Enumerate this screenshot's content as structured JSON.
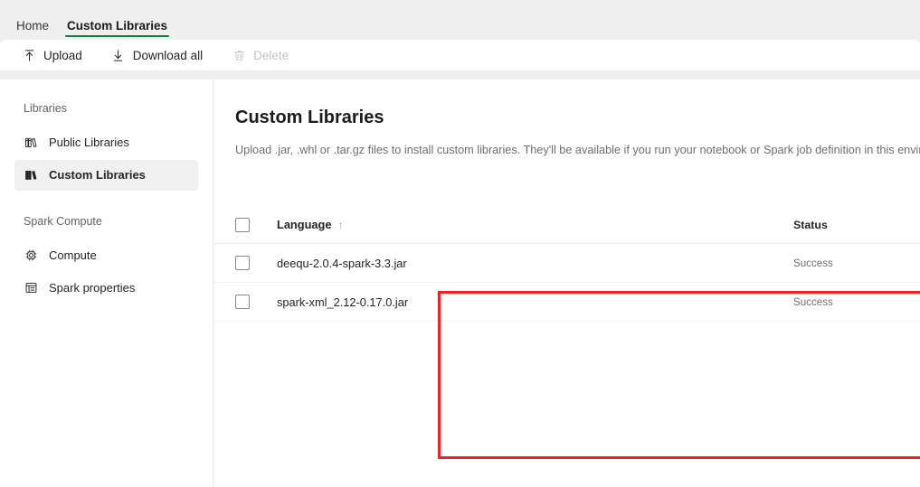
{
  "tabs": [
    {
      "label": "Home",
      "active": false,
      "name": "tab-home"
    },
    {
      "label": "Custom Libraries",
      "active": true,
      "name": "tab-custom-libraries"
    }
  ],
  "toolbar": {
    "upload_label": "Upload",
    "download_all_label": "Download all",
    "delete_label": "Delete",
    "upload_icon": "upload-icon",
    "download_icon": "download-icon",
    "delete_icon": "trash-icon",
    "delete_disabled": true
  },
  "sidebar": {
    "groups": [
      {
        "label": "Libraries",
        "items": [
          {
            "label": "Public Libraries",
            "icon": "books-outline-icon",
            "selected": false
          },
          {
            "label": "Custom Libraries",
            "icon": "books-filled-icon",
            "selected": true
          }
        ]
      },
      {
        "label": "Spark Compute",
        "items": [
          {
            "label": "Compute",
            "icon": "cpu-chip-icon",
            "selected": false
          },
          {
            "label": "Spark properties",
            "icon": "list-table-icon",
            "selected": false
          }
        ]
      }
    ]
  },
  "main": {
    "title": "Custom Libraries",
    "description": "Upload .jar, .whl or .tar.gz files to install custom libraries. They'll be available if you run your notebook or Spark job definition in this environment"
  },
  "table": {
    "columns": {
      "language": "Language",
      "status": "Status"
    },
    "sort_indicator": "↑",
    "sort_column": "Language",
    "sort_direction": "ascending",
    "rows": [
      {
        "name": "deequ-2.0.4-spark-3.3.jar",
        "status": "Success",
        "checked": false
      },
      {
        "name": "spark-xml_2.12-0.17.0.jar",
        "status": "Success",
        "checked": false
      }
    ]
  },
  "annotation": {
    "color": "#ee2222",
    "shape": "rectangle-highlight"
  },
  "colors": {
    "accent_tab_underline": "#107c41",
    "page_background": "#efefef",
    "surface": "#ffffff",
    "annotation_red": "#ee2222"
  }
}
